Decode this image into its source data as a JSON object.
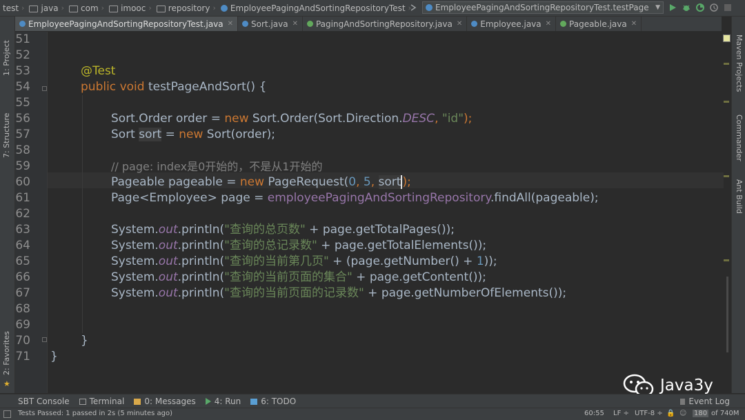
{
  "navbar": {
    "crumbs": [
      "test",
      "java",
      "com",
      "imooc",
      "repository",
      "EmployeePagingAndSortingRepositoryTest"
    ],
    "run_config": "EmployeePagingAndSortingRepositoryTest.testPage"
  },
  "tabs": [
    {
      "label": "EmployeePagingAndSortingRepositoryTest.java",
      "active": true
    },
    {
      "label": "Sort.java",
      "active": false
    },
    {
      "label": "PagingAndSortingRepository.java",
      "active": false
    },
    {
      "label": "Employee.java",
      "active": false
    },
    {
      "label": "Pageable.java",
      "active": false
    }
  ],
  "left_panels": {
    "project": "1: Project",
    "structure": "7: Structure",
    "favorites": "2: Favorites"
  },
  "right_panels": {
    "maven": "Maven Projects",
    "commander": "Commander",
    "ant": "Ant Build"
  },
  "line_numbers": [
    "51",
    "52",
    "53",
    "54",
    "55",
    "56",
    "57",
    "58",
    "59",
    "60",
    "61",
    "62",
    "63",
    "64",
    "65",
    "66",
    "67",
    "68",
    "69",
    "70",
    "71"
  ],
  "code": {
    "l53_annotation": "@Test",
    "l54_public": "public",
    "l54_void": "void",
    "l54_sig": "testPageAndSort() {",
    "l56_a": "Sort.Order order = ",
    "l56_new": "new",
    "l56_b": " Sort.Order(Sort.Direction.",
    "l56_desc": "DESC",
    "l56_c": ", ",
    "l56_str": "\"id\"",
    "l56_d": ");",
    "l57_a": "Sort ",
    "l57_var": "sort",
    "l57_b": " = ",
    "l57_new": "new",
    "l57_c": " Sort(order);",
    "l59_comment": "// page: index是0开始的，不是从1开始的",
    "l60_a": "Pageable pageable = ",
    "l60_new": "new",
    "l60_b": " PageRequest(",
    "l60_n0": "0",
    "l60_c": ", ",
    "l60_n5": "5",
    "l60_d": ", ",
    "l60_sort": "sort",
    "l60_e": ");",
    "l61_a": "Page<Employee> page = ",
    "l61_field": "employeePagingAndSortingRepository",
    "l61_b": ".findAll(pageable);",
    "l63_a": "System.",
    "l63_out": "out",
    "l63_b": ".println(",
    "l63_str": "\"查询的总页数\"",
    "l63_c": " + page.getTotalPages());",
    "l64_a": "System.",
    "l64_out": "out",
    "l64_b": ".println(",
    "l64_str": "\"查询的总记录数\"",
    "l64_c": " + page.getTotalElements());",
    "l65_a": "System.",
    "l65_out": "out",
    "l65_b": ".println(",
    "l65_str": "\"查询的当前第几页\"",
    "l65_c": " + (page.getNumber() + ",
    "l65_n1": "1",
    "l65_d": "));",
    "l66_a": "System.",
    "l66_out": "out",
    "l66_b": ".println(",
    "l66_str": "\"查询的当前页面的集合\"",
    "l66_c": " + page.getContent());",
    "l67_a": "System.",
    "l67_out": "out",
    "l67_b": ".println(",
    "l67_str": "\"查询的当前页面的记录数\"",
    "l67_c": " + page.getNumberOfElements());",
    "l70_close": "}",
    "l71_close": "}"
  },
  "tool_windows": [
    {
      "label": "SBT Console",
      "icon": "sbt-icon"
    },
    {
      "label": "Terminal",
      "icon": "terminal-icon"
    },
    {
      "label": "0: Messages",
      "icon": "messages-icon"
    },
    {
      "label": "4: Run",
      "icon": "run-icon"
    },
    {
      "label": "6: TODO",
      "icon": "todo-icon"
    }
  ],
  "event_log": "Event Log",
  "status": {
    "message": "Tests Passed: 1 passed in 2s (5 minutes ago)",
    "position": "60:55",
    "line_sep": "LF ÷",
    "encoding": "UTF-8 ÷",
    "memory_used": "180",
    "memory_of": "of 740M"
  },
  "watermark": {
    "text": "Java3y"
  },
  "colors": {
    "keyword": "#cc7832",
    "string": "#6a8759",
    "number": "#6897bb",
    "comment": "#808080",
    "annotation": "#bbb529",
    "field": "#9876aa"
  }
}
